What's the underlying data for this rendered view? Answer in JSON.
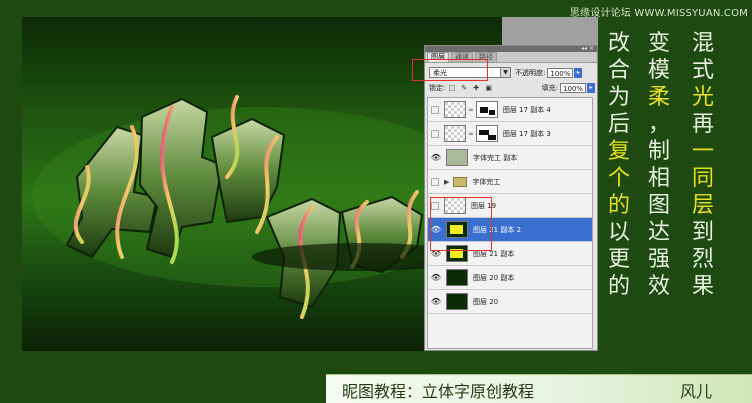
{
  "watermark": "思缘设计论坛 WWW.MISSYUAN.COM",
  "artwork": {
    "description_label": "3D green calligraphy text artwork"
  },
  "panel": {
    "tabs": [
      "图层",
      "通道",
      "路径"
    ],
    "active_tab": "图层",
    "blend_mode": "柔光",
    "opacity_label": "不透明度:",
    "opacity_value": "100%",
    "lock_label": "锁定:",
    "lock_icons": "□ ✎ ✚ ▣",
    "fill_label": "填充:",
    "fill_value": "100%",
    "layers": [
      {
        "name": "图层 17 副本 4",
        "visible": false,
        "thumb": "checker",
        "mask": true
      },
      {
        "name": "图层 17 副本 3",
        "visible": false,
        "thumb": "checker",
        "mask": true
      },
      {
        "name": "字体完工 副本",
        "visible": true,
        "thumb": "green",
        "mask": false
      },
      {
        "name": "字体完工",
        "visible": false,
        "thumb": "folder",
        "mask": false
      },
      {
        "name": "图层 19",
        "visible": false,
        "thumb": "checker",
        "mask": false
      },
      {
        "name": "图层 21 副本 2",
        "visible": true,
        "thumb": "yellow",
        "mask": false,
        "selected": true
      },
      {
        "name": "图层 21 副本",
        "visible": true,
        "thumb": "yellow",
        "mask": false
      },
      {
        "name": "图层 20 副本",
        "visible": true,
        "thumb": "dark",
        "mask": false
      },
      {
        "name": "图层 20",
        "visible": true,
        "thumb": "dark",
        "mask": false
      }
    ]
  },
  "instruction_columns": [
    [
      "改",
      "合",
      "为",
      "后",
      "复",
      "个",
      "的",
      "以",
      "更",
      "的"
    ],
    [
      "变",
      "模",
      "柔",
      "，",
      "制",
      "相",
      "图",
      "达",
      "强",
      "效"
    ],
    [
      "混",
      "式",
      "光",
      "再",
      "一",
      "同",
      "层",
      "到",
      "烈",
      "果"
    ]
  ],
  "highlight_chars": [
    "柔",
    "光",
    "复",
    "个",
    "的",
    "一",
    "同",
    "层"
  ],
  "footer": {
    "title": "昵图教程：立体字原创教程",
    "author": "风儿"
  },
  "colors": {
    "background": "#1e4a12",
    "highlight_text": "#e6e020",
    "plain_text": "#e8f0e0",
    "selection": "#3a6fcf",
    "annotation_red": "#e0302a"
  }
}
